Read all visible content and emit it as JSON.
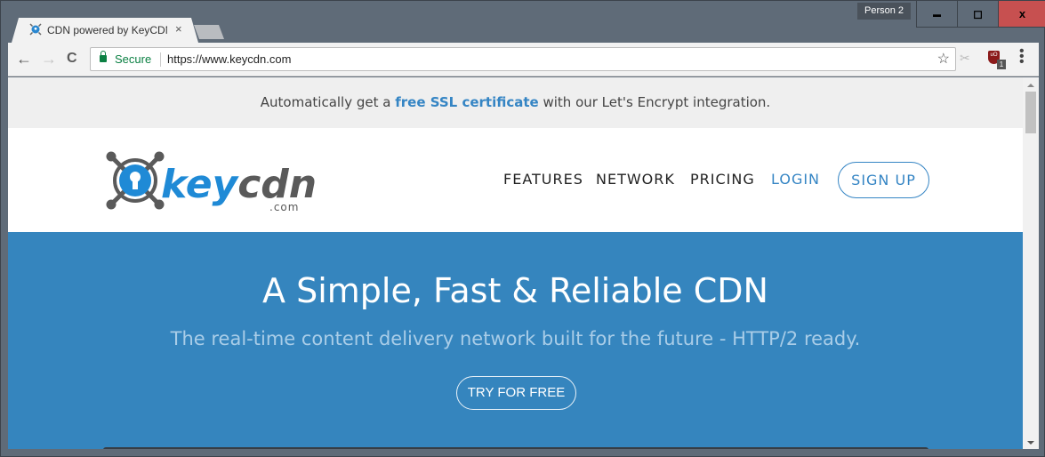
{
  "browser": {
    "tab": {
      "title": "CDN powered by KeyCDN",
      "favicon": "keycdn-logo-icon",
      "close_icon": "×"
    },
    "profile": "Person 2",
    "window_controls": {
      "minimize": "▬",
      "maximize": "◻",
      "close": "x"
    },
    "nav": {
      "back": "←",
      "forward": "→",
      "reload": "C"
    },
    "omnibox": {
      "secure_label": "Secure",
      "url": "https://www.keycdn.com"
    },
    "bookmark_icon": "☆",
    "extensions": [
      {
        "name": "scissors-icon",
        "glyph": "✂"
      },
      {
        "name": "ublock-icon",
        "glyph": "uO",
        "badge": "1"
      }
    ],
    "menu_icon": "⋮"
  },
  "page": {
    "announcement": {
      "prefix": "Automatically get a ",
      "link": "free SSL certificate",
      "suffix": " with our Let's Encrypt integration."
    },
    "logo": {
      "word": "keycdn",
      "domain": ".com"
    },
    "nav": [
      {
        "label": "FEATURES"
      },
      {
        "label": "NETWORK"
      },
      {
        "label": "PRICING"
      },
      {
        "label": "LOGIN"
      }
    ],
    "signup_label": "SIGN UP",
    "hero": {
      "title": "A Simple, Fast & Reliable CDN",
      "subtitle": "The real-time content delivery network built for the future - HTTP/2 ready.",
      "cta": "TRY FOR FREE"
    }
  },
  "colors": {
    "brand_blue": "#3585c4",
    "hero_bg": "#3585be",
    "logo_gray": "#5a5a5a"
  }
}
